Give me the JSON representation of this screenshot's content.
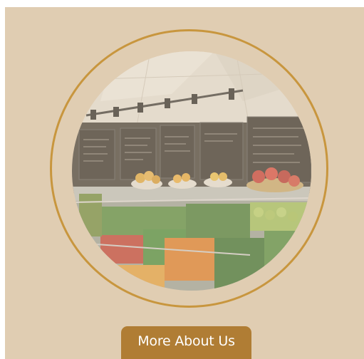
{
  "colors": {
    "background": "#e0cdb2",
    "accent_ring": "#c8963e",
    "button": "#b07d34",
    "button_text": "#ffffff"
  },
  "cta": {
    "label": "More About Us"
  }
}
